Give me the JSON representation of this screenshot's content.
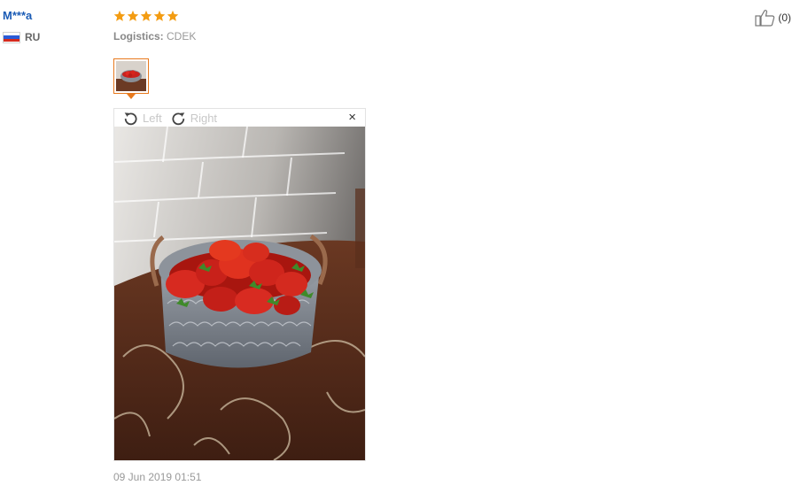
{
  "user": {
    "name": "M***a",
    "country_code": "RU"
  },
  "review": {
    "rating": 5,
    "rating_max": 5,
    "logistics_label": "Logistics:",
    "logistics_value": "CDEK",
    "date": "09 Jun 2019 01:51"
  },
  "viewer": {
    "left_label": "Left",
    "right_label": "Right",
    "close_label": "×"
  },
  "feedback": {
    "like_count": "(0)"
  },
  "colors": {
    "star": "#f39c12",
    "accent": "#e8791d",
    "username": "#1a5bb5"
  },
  "icons": [
    "star-icon",
    "rotate-left-icon",
    "rotate-right-icon",
    "close-icon",
    "thumbs-up-icon",
    "flag-ru-icon"
  ]
}
